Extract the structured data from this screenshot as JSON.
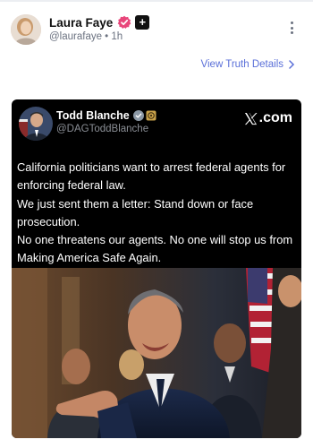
{
  "post": {
    "author_name": "Laura Faye",
    "handle_time": "@laurafaye • 1h",
    "view_details_label": "View Truth Details"
  },
  "embed": {
    "author_name": "Todd Blanche",
    "handle": "@DAGToddBlanche",
    "source": ".com",
    "lines": [
      "California politicians want to arrest federal agents for enforcing federal law.",
      "We just sent them a letter: Stand down or face prosecution.",
      "No one threatens our agents. No one will stop us from Making America Safe Again."
    ]
  },
  "colors": {
    "accent": "#5a6fd8",
    "verified_pink": "#e8457a",
    "verified_blue": "#1d9bf0",
    "card_bg": "#000000"
  },
  "icons": [
    "verified-icon",
    "plus-badge-icon",
    "more-options-icon",
    "chevron-right-icon",
    "x-logo-icon",
    "gov-verified-icon"
  ]
}
